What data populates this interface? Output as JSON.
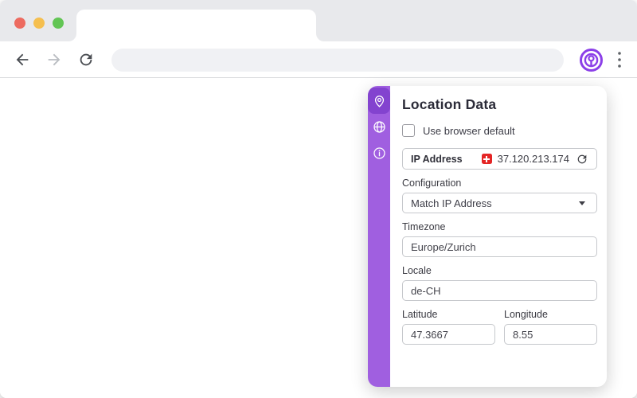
{
  "theme": {
    "accent": "#a05fe0",
    "accent-dark": "#8343cf",
    "logo-purple": "#8b3fe8",
    "flag-red": "#e42525",
    "traffic-red": "#ed6b60",
    "traffic-yellow": "#f5bf4f",
    "traffic-green": "#62c554"
  },
  "browser": {
    "icons": [
      "back-arrow-icon",
      "forward-arrow-icon",
      "reload-icon",
      "vytal-extension-icon",
      "kebab-menu-icon"
    ],
    "address_bar_value": ""
  },
  "panel": {
    "title": "Location Data",
    "default_checkbox": {
      "label": "Use browser default",
      "checked": false
    },
    "ip": {
      "label": "IP Address",
      "value": "37.120.213.174",
      "flag": "swiss-flag-icon",
      "action": "refresh-icon"
    },
    "fields": {
      "configuration": {
        "label": "Configuration",
        "value": "Match IP Address",
        "type": "select"
      },
      "timezone": {
        "label": "Timezone",
        "value": "Europe/Zurich"
      },
      "locale": {
        "label": "Locale",
        "value": "de-CH"
      },
      "latitude": {
        "label": "Latitude",
        "value": "47.3667"
      },
      "longitude": {
        "label": "Longitude",
        "value": "8.55"
      }
    },
    "sidebar": [
      {
        "icon": "location-pin-icon",
        "active": true
      },
      {
        "icon": "globe-icon",
        "active": false
      },
      {
        "icon": "info-icon",
        "active": false
      }
    ]
  }
}
